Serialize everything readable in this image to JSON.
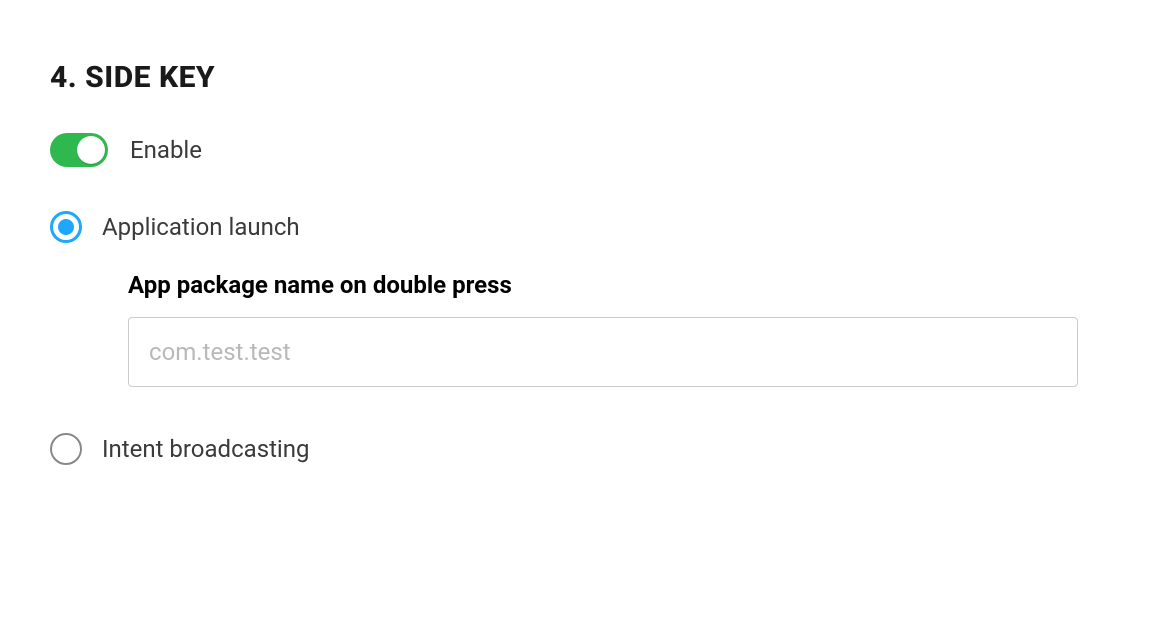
{
  "section": {
    "heading": "4. SIDE KEY"
  },
  "toggle": {
    "label": "Enable",
    "on": true
  },
  "options": {
    "application_launch": {
      "label": "Application launch",
      "selected": true,
      "field_label": "App package name on double press",
      "placeholder": "com.test.test",
      "value": ""
    },
    "intent_broadcasting": {
      "label": "Intent broadcasting",
      "selected": false
    }
  }
}
